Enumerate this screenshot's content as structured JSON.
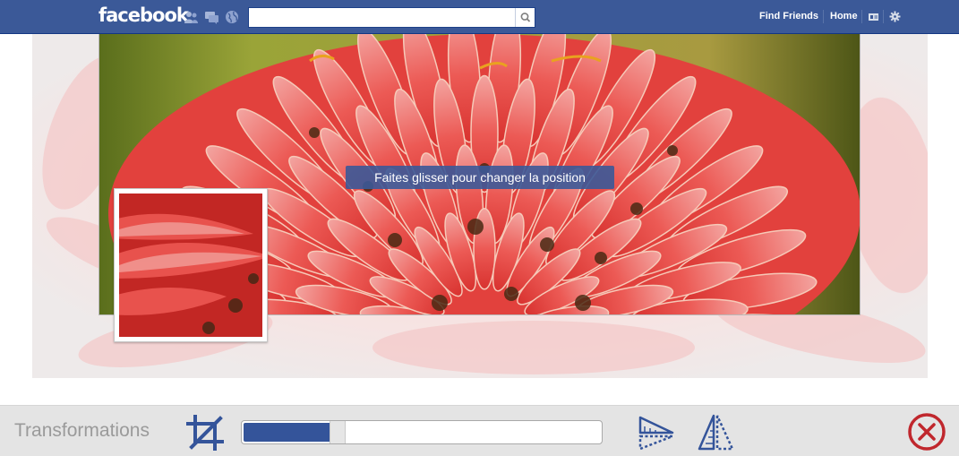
{
  "header": {
    "logo": "facebook",
    "search": {
      "placeholder": "",
      "value": ""
    },
    "nav": {
      "find_friends": "Find Friends",
      "home": "Home"
    },
    "icons": [
      "friend-requests-icon",
      "messages-icon",
      "notifications-icon",
      "search-icon",
      "privacy-shortcuts-icon",
      "settings-gear-icon"
    ],
    "bar_color": "#3b5998"
  },
  "cover": {
    "drag_tooltip": "Faites glisser pour changer la position"
  },
  "toolbar": {
    "title": "Transformations",
    "slider_value": 0.24,
    "icons": [
      "crop-icon",
      "flip-horizontal-icon",
      "flip-vertical-icon",
      "close-icon"
    ],
    "accent_color": "#34549a",
    "close_color": "#c0272d"
  }
}
